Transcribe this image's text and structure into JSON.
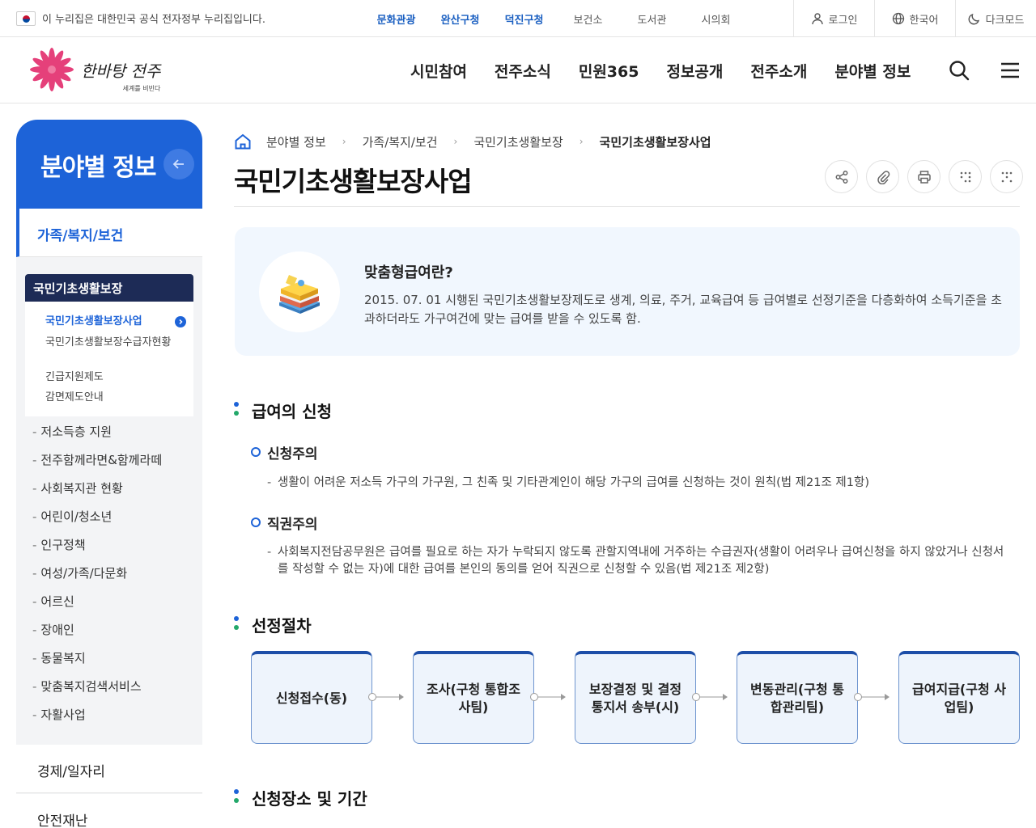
{
  "govbar": {
    "notice": "이 누리집은 대한민국 공식 전자정부 누리집입니다.",
    "links": [
      {
        "label": "문화관광",
        "highlight": true
      },
      {
        "label": "완산구청",
        "highlight": true
      },
      {
        "label": "덕진구청",
        "highlight": true
      },
      {
        "label": "보건소",
        "highlight": false
      },
      {
        "label": "도서관",
        "highlight": false
      },
      {
        "label": "시의회",
        "highlight": false
      }
    ],
    "login": "로그인",
    "language": "한국어",
    "darkmode": "다크모드"
  },
  "header": {
    "logo_main": "한바탕 전주",
    "logo_sub": "세계를 비빈다",
    "nav": [
      "시민참여",
      "전주소식",
      "민원365",
      "정보공개",
      "전주소개",
      "분야별 정보"
    ]
  },
  "sidebar": {
    "title": "분야별 정보",
    "category": "가족/복지/보건",
    "active_group": "국민기초생활보장",
    "sub_items": [
      {
        "label": "국민기초생활보장사업",
        "active": true
      },
      {
        "label": "국민기초생활보장수급자현황",
        "active": false
      },
      {
        "label": "긴급지원제도",
        "active": false
      },
      {
        "label": "감면제도안내",
        "active": false
      }
    ],
    "groups": [
      "저소득층 지원",
      "전주함께라면&함께라떼",
      "사회복지관 현황",
      "어린이/청소년",
      "인구정책",
      "여성/가족/다문화",
      "어르신",
      "장애인",
      "동물복지",
      "맞춤복지검색서비스",
      "자활사업"
    ],
    "other_categories": [
      "경제/일자리",
      "안전재난"
    ]
  },
  "breadcrumb": [
    "분야별 정보",
    "가족/복지/보건",
    "국민기초생활보장",
    "국민기초생활보장사업"
  ],
  "page_title": "국민기초생활보장사업",
  "info": {
    "title": "맞춤형급여란?",
    "desc": "2015. 07. 01 시행된 국민기초생활보장제도로 생계, 의료, 주거, 교육급여 등 급여별로 선정기준을 다층화하여 소득기준을 초과하더라도 가구여건에 맞는 급여를 받을 수 있도록 함."
  },
  "sections": {
    "apply": {
      "title": "급여의 신청",
      "sub1_title": "신청주의",
      "sub1_text": "생활이 어려운 저소득 가구의 가구원, 그 친족 및 기타관계인이 해당 가구의 급여를 신청하는 것이 원칙(법 제21조 제1항)",
      "sub2_title": "직권주의",
      "sub2_text": "사회복지전담공무원은 급여를 필요로 하는 자가 누락되지 않도록 관할지역내에 거주하는 수급권자(생활이 어려우나 급여신청을 하지 않았거나 신청서를 작성할 수 없는 자)에 대한 급여를 본인의 동의를 얻어 직권으로 신청할 수 있음(법 제21조 제2항)"
    },
    "procedure": {
      "title": "선정절차",
      "steps": [
        "신청접수(동)",
        "조사(구청 통합조사팀)",
        "보장결정 및 결정통지서 송부(시)",
        "변동관리(구청 통합관리팀)",
        "급여지급(구청 사업팀)"
      ]
    },
    "place": {
      "title": "신청장소 및 기간"
    }
  }
}
